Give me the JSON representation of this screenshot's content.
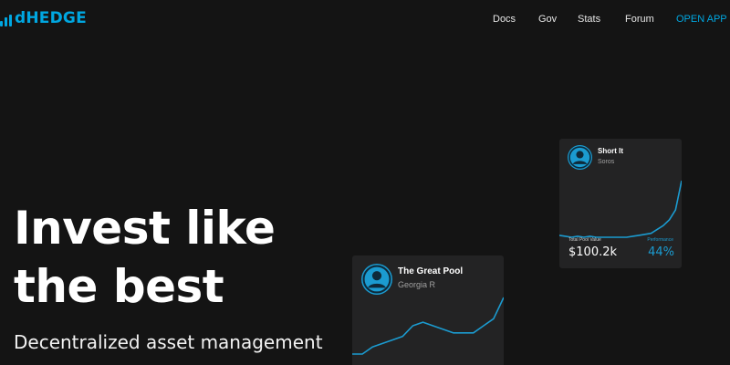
{
  "brand": {
    "name": "dHEDGE",
    "accent_color": "#00a7e1"
  },
  "nav": {
    "docs": "Docs",
    "gov": "Gov",
    "stats": "Stats",
    "forum": "Forum",
    "open_app": "OPEN APP"
  },
  "hero": {
    "title_line1": "Invest like",
    "title_line2": "the best",
    "subtitle": "Decentralized asset management"
  },
  "cards": [
    {
      "name": "Short It",
      "manager": "Soros",
      "total_value_label": "Total Pool Value",
      "total_value": "$100.2k",
      "performance_label": "Performance",
      "performance": "44%",
      "avatar_icon": "user-avatar-icon",
      "line_color": "#1b9bd0",
      "series": [
        4,
        3,
        2,
        3,
        2,
        3,
        2,
        2,
        2,
        2,
        2,
        2,
        3,
        4,
        5,
        6,
        10,
        14,
        20,
        30,
        60
      ]
    },
    {
      "name": "The Great Pool",
      "manager": "Georgia R",
      "avatar_icon": "user-avatar-icon",
      "line_color": "#1b9bd0",
      "series": [
        2,
        2,
        4,
        5,
        6,
        7,
        10,
        11,
        10,
        9,
        8,
        8,
        8,
        10,
        12,
        18
      ]
    }
  ]
}
